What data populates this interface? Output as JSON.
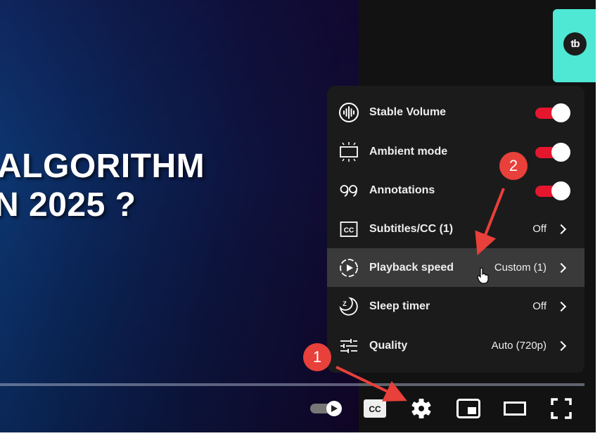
{
  "video": {
    "headline_line1": "ALGORITHM",
    "headline_line2": "N 2025 ?"
  },
  "side_panel": {
    "logo_text": "tb",
    "color": "#4ee8d4"
  },
  "settings_menu": {
    "items": [
      {
        "label": "Stable Volume",
        "icon": "stable-volume-icon",
        "type": "toggle",
        "on": true
      },
      {
        "label": "Ambient mode",
        "icon": "ambient-mode-icon",
        "type": "toggle",
        "on": true
      },
      {
        "label": "Annotations",
        "icon": "annotations-icon",
        "type": "toggle",
        "on": true
      },
      {
        "label": "Subtitles/CC (1)",
        "icon": "subtitles-icon",
        "type": "submenu",
        "value": "Off"
      },
      {
        "label": "Playback speed",
        "icon": "playback-speed-icon",
        "type": "submenu",
        "value": "Custom (1)",
        "hovered": true
      },
      {
        "label": "Sleep timer",
        "icon": "sleep-timer-icon",
        "type": "submenu",
        "value": "Off"
      },
      {
        "label": "Quality",
        "icon": "quality-icon",
        "type": "submenu",
        "value": "Auto (720p)"
      }
    ],
    "toggle_color": "#e6162f"
  },
  "controls": {
    "autoplay": "autoplay-toggle-icon",
    "cc": "CC",
    "settings": "settings-gear-icon",
    "miniplayer": "miniplayer-icon",
    "theater": "theater-mode-icon",
    "fullscreen": "fullscreen-icon"
  },
  "annotations": {
    "step1": "1",
    "step2": "2",
    "color": "#e8403a"
  }
}
